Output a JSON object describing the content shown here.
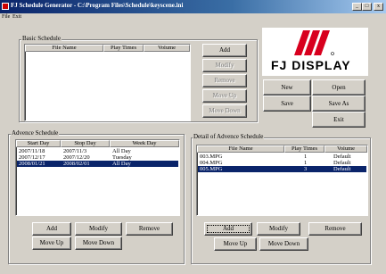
{
  "window": {
    "title": "FJ Schedule Generator - C:\\Program Files\\Schedule\\keyscene.ini"
  },
  "menu": [
    "File",
    "Exit"
  ],
  "basic": {
    "title": "Basic Schedule",
    "columns": [
      "File Name",
      "Play Times",
      "Volume"
    ],
    "buttons": {
      "add": "Add",
      "modify": "Modify",
      "remove": "Remove",
      "move_up": "Move Up",
      "move_down": "Move Down"
    }
  },
  "logo": {
    "text": "FJ DISPLAY",
    "brand_color": "#d8001e"
  },
  "file_buttons": {
    "new": "New",
    "open": "Open",
    "save": "Save",
    "save_as": "Save As",
    "exit": "Exit"
  },
  "advance": {
    "title": "Advence Schedule",
    "columns": [
      "Start Day",
      "Stop Day",
      "Week Day"
    ],
    "rows": [
      {
        "start": "2007/11/18",
        "stop": "2007/11/3",
        "week": "All Day"
      },
      {
        "start": "2007/12/17",
        "stop": "2007/12/20",
        "week": "Tuesday"
      },
      {
        "start": "2008/01/21",
        "stop": "2008/02/01",
        "week": "All Day"
      }
    ],
    "selected_row": 2,
    "buttons": {
      "add": "Add",
      "modify": "Modify",
      "remove": "Remove",
      "move_up": "Move Up",
      "move_down": "Move Down"
    }
  },
  "detail": {
    "title": "Detail of Advence Schedule",
    "columns": [
      "File Name",
      "Play Times",
      "Volume"
    ],
    "rows": [
      {
        "file": "003.MPG",
        "times": "1",
        "volume": "Default"
      },
      {
        "file": "004.MPG",
        "times": "1",
        "volume": "Default"
      },
      {
        "file": "005.MPG",
        "times": "3",
        "volume": "Default"
      }
    ],
    "selected_row": 2,
    "buttons": {
      "add": "Add",
      "modify": "Modify",
      "remove": "Remove",
      "move_up": "Move Up",
      "move_down": "Move Down"
    }
  }
}
